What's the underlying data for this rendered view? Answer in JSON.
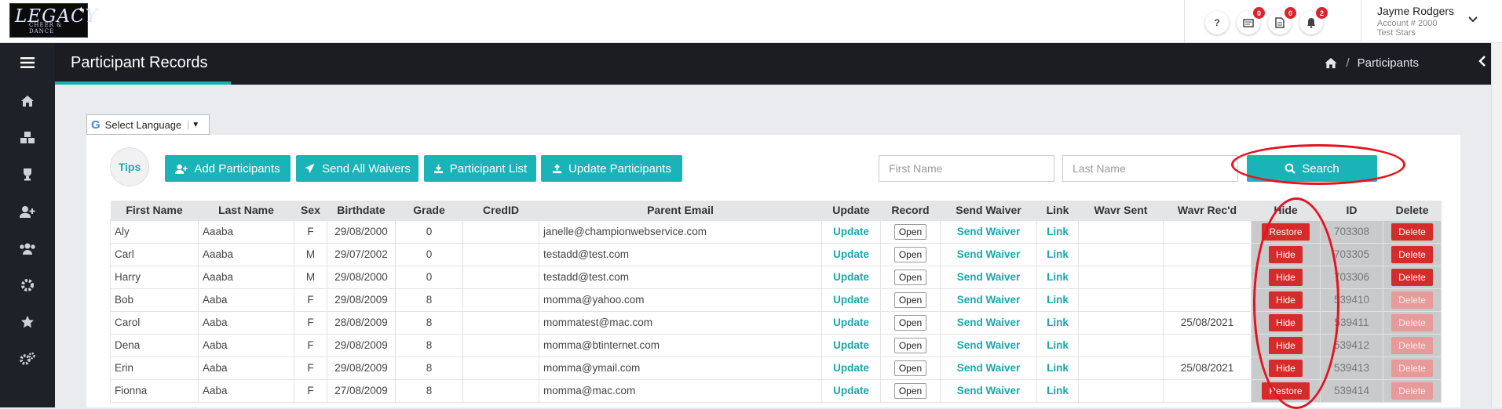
{
  "logo": {
    "text": "LEGACY",
    "sub": "CHEER & DANCE"
  },
  "topbar": {
    "help_label": "?",
    "badges": [
      "0",
      "0",
      "2"
    ],
    "user_name": "Jayme Rodgers",
    "account": "Account # 2000",
    "team": "Test Stars"
  },
  "header": {
    "title": "Participant Records",
    "breadcrumb": "Participants"
  },
  "language": {
    "label": "Select Language"
  },
  "toolbar": {
    "tips": "Tips",
    "add_participants": "Add Participants",
    "send_all_waivers": "Send All Waivers",
    "participant_list": "Participant List",
    "update_participants": "Update Participants",
    "search": "Search"
  },
  "search": {
    "first_placeholder": "First Name",
    "last_placeholder": "Last Name"
  },
  "table": {
    "headers": [
      "First Name",
      "Last Name",
      "Sex",
      "Birthdate",
      "Grade",
      "CredID",
      "Parent Email",
      "Update",
      "Record",
      "Send Waiver",
      "Link",
      "Wavr Sent",
      "Wavr Rec'd",
      "Hide",
      "ID",
      "Delete"
    ],
    "update_label": "Update",
    "open_label": "Open",
    "send_waiver_label": "Send Waiver",
    "link_label": "Link",
    "rows": [
      {
        "first": "Aly",
        "last": "Aaaba",
        "sex": "F",
        "birth": "29/08/2000",
        "grade": "0",
        "email": "janelle@championwebservice.com",
        "recd": "",
        "hide": "Restore",
        "id": "703308",
        "delete": "Delete"
      },
      {
        "first": "Carl",
        "last": "Aaaba",
        "sex": "M",
        "birth": "29/07/2002",
        "grade": "0",
        "email": "testadd@test.com",
        "recd": "",
        "hide": "Hide",
        "id": "703305",
        "delete": "Delete"
      },
      {
        "first": "Harry",
        "last": "Aaaba",
        "sex": "M",
        "birth": "29/08/2000",
        "grade": "0",
        "email": "testadd@test.com",
        "recd": "",
        "hide": "Hide",
        "id": "703306",
        "delete": "Delete"
      },
      {
        "first": "Bob",
        "last": "Aaba",
        "sex": "F",
        "birth": "29/08/2009",
        "grade": "8",
        "email": "momma@yahoo.com",
        "recd": "",
        "hide": "Hide",
        "id": "539410",
        "delete": "Delete"
      },
      {
        "first": "Carol",
        "last": "Aaba",
        "sex": "F",
        "birth": "28/08/2009",
        "grade": "8",
        "email": "mommatest@mac.com",
        "recd": "25/08/2021",
        "hide": "Hide",
        "id": "539411",
        "delete": "Delete"
      },
      {
        "first": "Dena",
        "last": "Aaba",
        "sex": "F",
        "birth": "29/08/2009",
        "grade": "8",
        "email": "momma@btinternet.com",
        "recd": "",
        "hide": "Hide",
        "id": "539412",
        "delete": "Delete"
      },
      {
        "first": "Erin",
        "last": "Aaba",
        "sex": "F",
        "birth": "29/08/2009",
        "grade": "8",
        "email": "momma@ymail.com",
        "recd": "25/08/2021",
        "hide": "Hide",
        "id": "539413",
        "delete": "Delete"
      },
      {
        "first": "Fionna",
        "last": "Aaba",
        "sex": "F",
        "birth": "27/08/2009",
        "grade": "8",
        "email": "momma@mac.com",
        "recd": "",
        "hide": "Restore",
        "id": "539414",
        "delete": "Delete"
      }
    ]
  }
}
